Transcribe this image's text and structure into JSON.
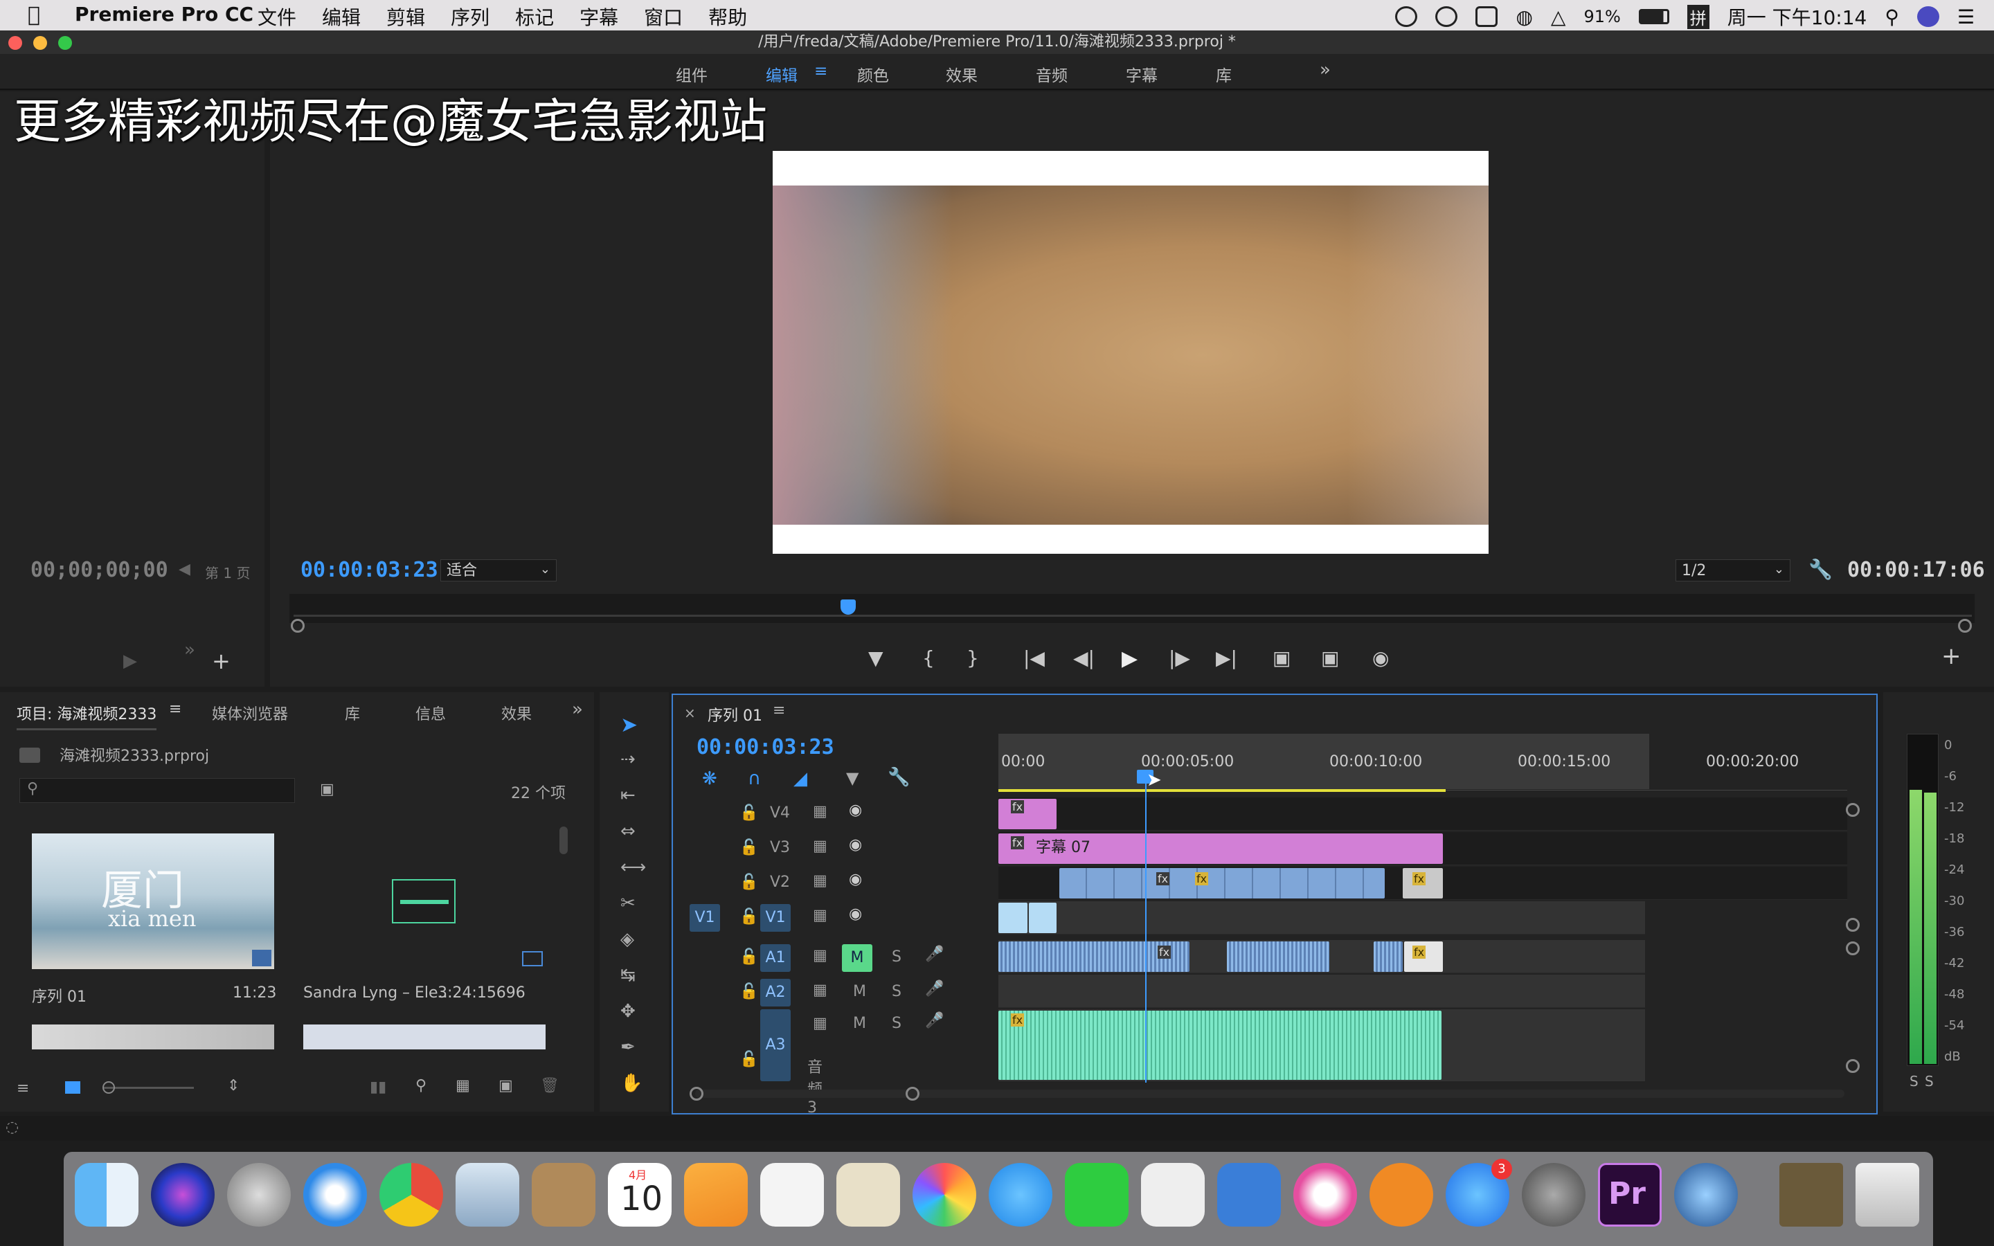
{
  "menubar": {
    "app_name": "Premiere Pro CC",
    "menus": [
      "文件",
      "编辑",
      "剪辑",
      "序列",
      "标记",
      "字幕",
      "窗口",
      "帮助"
    ],
    "battery": "91%",
    "input_method": "拼",
    "clock": "周一 下午10:14"
  },
  "window": {
    "title": "/用户/freda/文稿/Adobe/Premiere Pro/11.0/海滩视频2333.prproj *"
  },
  "workspace": {
    "tabs": [
      "组件",
      "编辑",
      "颜色",
      "效果",
      "音频",
      "字幕",
      "库"
    ],
    "active": "编辑",
    "overflow": "»"
  },
  "watermark": "更多精彩视频尽在@魔女宅急影视站",
  "source_monitor": {
    "timecode": "00;00;00;00",
    "page_label": "第 1 页"
  },
  "program_monitor": {
    "timecode": "00:00:03:23",
    "zoom": "适合",
    "resolution": "1/2",
    "duration": "00:00:17:06",
    "playhead_fraction": 0.33
  },
  "project_panel": {
    "tabs": [
      "项目: 海滩视频2333",
      "媒体浏览器",
      "库",
      "信息",
      "效果"
    ],
    "file": "海滩视频2333.prproj",
    "item_count": "22 个项",
    "items": [
      {
        "name": "序列 01",
        "duration": "11:23",
        "thumb_title": "厦门",
        "thumb_sub": "xia men"
      },
      {
        "name": "Sandra Lyng – Ele...",
        "duration": "3:24:15696"
      }
    ]
  },
  "timeline": {
    "sequence_tab": "序列 01",
    "timecode": "00:00:03:23",
    "ruler": [
      "00:00",
      "00:00:05:00",
      "00:00:10:00",
      "00:00:15:00",
      "00:00:20:00"
    ],
    "video_tracks": [
      "V4",
      "V3",
      "V2",
      "V1"
    ],
    "audio_tracks": [
      "A1",
      "A2",
      "A3"
    ],
    "source_patch": "V1",
    "track_buttons": {
      "mute": "M",
      "solo": "S"
    },
    "title_clip": "字幕 07",
    "audio3_name": "音频 3",
    "fx": "fx"
  },
  "meter": {
    "scale": [
      "0",
      "-6",
      "-12",
      "-18",
      "-24",
      "-30",
      "-36",
      "-42",
      "-48",
      "-54",
      "dB"
    ],
    "solo": [
      "S",
      "S"
    ]
  },
  "dock": {
    "calendar_month": "4月",
    "calendar_day": "10",
    "appstore_badge": "3",
    "pr_label": "Pr"
  },
  "colors": {
    "accent": "#3d9bff",
    "title_clip": "#d27fd6",
    "video_clip": "#7fa6d8",
    "audio_clip": "#7de8c8"
  }
}
